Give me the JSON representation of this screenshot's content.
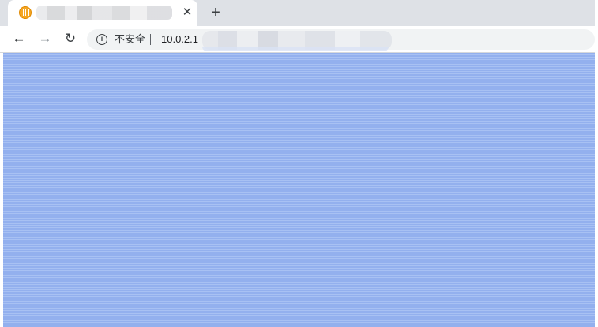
{
  "tab": {
    "favicon": "orange-logo-icon",
    "title": "",
    "close_label": "✕"
  },
  "new_tab": {
    "label": "+"
  },
  "toolbar": {
    "back_label": "←",
    "forward_label": "→",
    "reload_label": "↻"
  },
  "omnibox": {
    "info_label": "i",
    "security_label": "不安全",
    "url_visible": "10.0.2.1"
  },
  "page": {
    "background_color": "#98b5f0"
  }
}
